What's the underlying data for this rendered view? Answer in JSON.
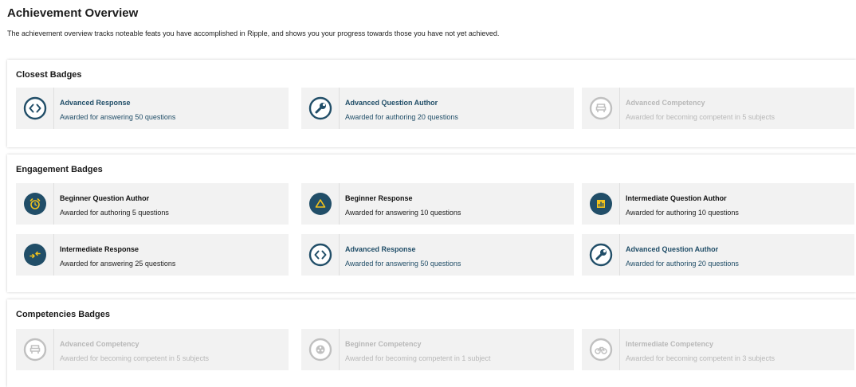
{
  "page": {
    "title": "Achievement Overview",
    "description": "The achievement overview tracks noteable feats you have accomplished in Ripple, and shows you your progress towards those you have not yet achieved."
  },
  "colors": {
    "earned_text": "#214e68",
    "icon_fill": "#214e68",
    "icon_accent": "#f2c21b",
    "locked": "#b8b8b8"
  },
  "sections": [
    {
      "title": "Closest Badges",
      "badges": [
        {
          "name": "Advanced Response",
          "desc": "Awarded for answering 50 questions",
          "state": "earned",
          "icon": "code-icon"
        },
        {
          "name": "Advanced Question Author",
          "desc": "Awarded for authoring 20 questions",
          "state": "earned",
          "icon": "wrench-icon"
        },
        {
          "name": "Advanced Competency",
          "desc": "Awarded for becoming competent in 5 subjects",
          "state": "locked",
          "icon": "armchair-icon"
        }
      ]
    },
    {
      "title": "Engagement Badges",
      "badges": [
        {
          "name": "Beginner Question Author",
          "desc": "Awarded for authoring 5 questions",
          "state": "plain",
          "icon": "alarm-clock-icon"
        },
        {
          "name": "Beginner Response",
          "desc": "Awarded for answering 10 questions",
          "state": "plain",
          "icon": "triangle-icon"
        },
        {
          "name": "Intermediate Question Author",
          "desc": "Awarded for authoring 10 questions",
          "state": "plain",
          "icon": "bar-chart-icon"
        },
        {
          "name": "Intermediate Response",
          "desc": "Awarded for answering 25 questions",
          "state": "plain",
          "icon": "exchange-arrows-icon"
        },
        {
          "name": "Advanced Response",
          "desc": "Awarded for answering 50 questions",
          "state": "earned",
          "icon": "code-icon"
        },
        {
          "name": "Advanced Question Author",
          "desc": "Awarded for authoring 20 questions",
          "state": "earned",
          "icon": "wrench-icon"
        }
      ]
    },
    {
      "title": "Competencies Badges",
      "badges": [
        {
          "name": "Advanced Competency",
          "desc": "Awarded for becoming competent in 5 subjects",
          "state": "locked",
          "icon": "armchair-icon"
        },
        {
          "name": "Beginner Competency",
          "desc": "Awarded for becoming competent in 1 subject",
          "state": "locked",
          "icon": "film-reel-icon"
        },
        {
          "name": "Intermediate Competency",
          "desc": "Awarded for becoming competent in 3 subjects",
          "state": "locked",
          "icon": "bicycle-icon"
        }
      ]
    }
  ]
}
